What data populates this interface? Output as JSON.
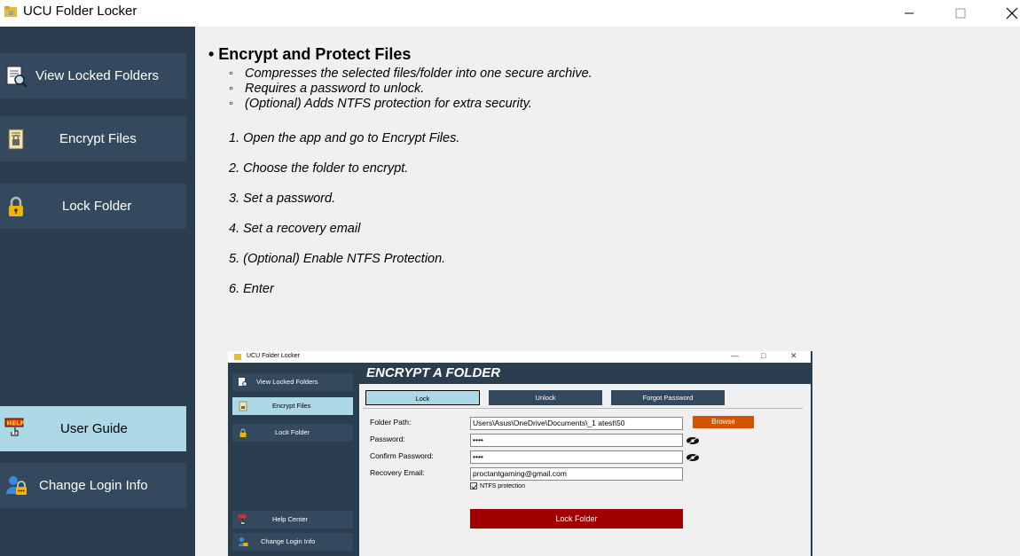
{
  "window": {
    "title": "UCU Folder Locker",
    "icons": {
      "app": "folder-lock-icon",
      "minimize": "minimize-icon",
      "maximize": "maximize-icon",
      "close": "close-icon"
    }
  },
  "sidebar": {
    "items": [
      {
        "label": "View Locked Folders",
        "icon": "magnifier-document-icon",
        "active": false
      },
      {
        "label": "Encrypt Files",
        "icon": "encrypted-file-icon",
        "active": false
      },
      {
        "label": "Lock Folder",
        "icon": "padlock-icon",
        "active": false
      },
      {
        "label": "User Guide",
        "icon": "help-hand-icon",
        "active": true
      },
      {
        "label": "Change Login Info",
        "icon": "user-lock-icon",
        "active": false
      }
    ]
  },
  "guide": {
    "heading": "• Encrypt and Protect Files",
    "bullets": [
      "Compresses the selected files/folder into one secure archive.",
      "Requires a password to unlock.",
      "(Optional) Adds NTFS protection for extra security."
    ],
    "steps": [
      "1. Open the app and go to Encrypt Files.",
      "2. Choose the folder to encrypt.",
      "3. Set a password.",
      "4. Set a recovery email",
      "5. (Optional) Enable NTFS Protection.",
      "6. Enter"
    ]
  },
  "screenshot": {
    "window_title": "UCU Folder Locker",
    "window_controls": [
      "—",
      "□",
      "✕"
    ],
    "sidebar": [
      "View Locked Folders",
      "Encrypt Files",
      "Lock Folder",
      "Help Center",
      "Change Login Info"
    ],
    "header": "ENCRYPT A FOLDER",
    "tabs": [
      "Lock",
      "Unlock",
      "Forgot Password"
    ],
    "form": {
      "folder_path_label": "Folder Path:",
      "folder_path_value": "Users\\Asus\\OneDrive\\Documents\\_1 atest\\50",
      "browse_label": "Browse",
      "password_label": "Password:",
      "password_value": "••••",
      "confirm_label": "Confirm Password:",
      "confirm_value": "••••",
      "recovery_label": "Recovery Email:",
      "recovery_value": "proctantgaming@gmail.com",
      "ntfs_label": "NTFS protection",
      "ntfs_checked": true,
      "lock_button": "Lock Folder"
    },
    "colors": {
      "accent": "#add8e6",
      "dark": "#2b3e50",
      "browse": "#d35400",
      "lock": "#a00000"
    }
  }
}
